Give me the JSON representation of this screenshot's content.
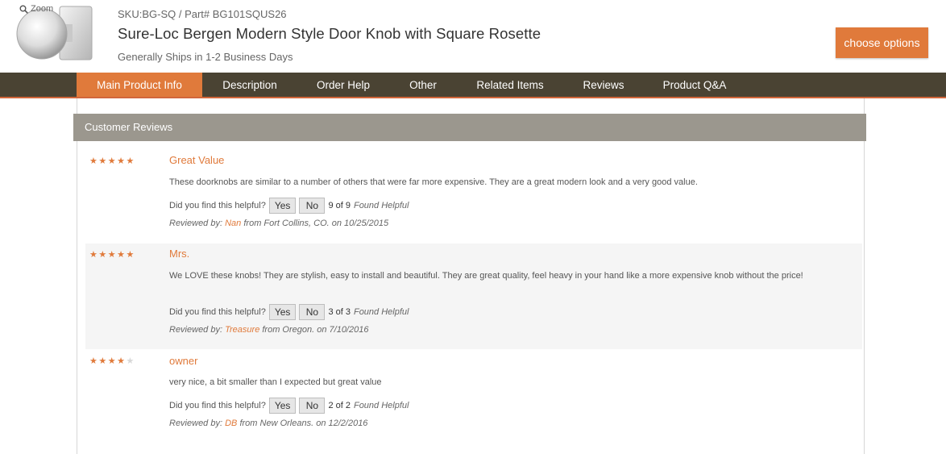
{
  "product": {
    "zoom_label": "Zoom",
    "sku_line": "SKU:BG-SQ / Part# BG101SQUS26",
    "title": "Sure-Loc Bergen Modern Style Door Knob with Square Rosette",
    "ships": "Generally Ships in 1-2 Business Days",
    "choose_label": "choose options"
  },
  "nav": {
    "tabs": [
      {
        "label": "Main Product Info",
        "active": true
      },
      {
        "label": "Description"
      },
      {
        "label": "Order Help"
      },
      {
        "label": "Other"
      },
      {
        "label": "Related Items"
      },
      {
        "label": "Reviews"
      },
      {
        "label": "Product Q&A"
      }
    ]
  },
  "reviews_section": {
    "heading": "Customer Reviews",
    "helpful_prompt": "Did you find this helpful?",
    "yes_label": "Yes",
    "no_label": "No",
    "found_label": "Found Helpful",
    "reviewed_by_label": "Reviewed by:",
    "items": [
      {
        "rating": 5,
        "title": "Great Value",
        "body": "These doorknobs are similar to a number of others that were far more expensive. They are a great modern look and a very good value.",
        "helpful_count": "9 of 9",
        "reviewer": "Nan",
        "location_date": "from Fort Collins, CO. on 10/25/2015"
      },
      {
        "rating": 5,
        "title": "Mrs.",
        "body": "We LOVE these knobs! They are stylish, easy to install and beautiful. They are great quality, feel heavy in your hand like a more expensive knob without the price!",
        "helpful_count": "3 of 3",
        "reviewer": "Treasure",
        "location_date": "from Oregon. on 7/10/2016"
      },
      {
        "rating": 4,
        "title": "owner",
        "body": "very nice, a bit smaller than I expected but great value",
        "helpful_count": "2 of 2",
        "reviewer": "DB",
        "location_date": "from New Orleans. on 12/2/2016"
      }
    ]
  },
  "colors": {
    "accent": "#e07a3b",
    "nav_bg": "#4a4333",
    "section_head_bg": "#9b978e"
  }
}
